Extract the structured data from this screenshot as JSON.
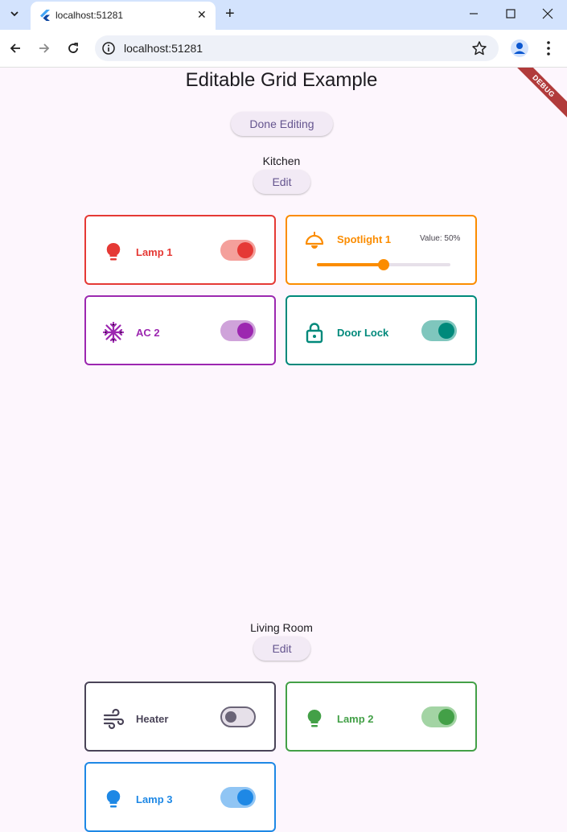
{
  "browser": {
    "tab_title": "localhost:51281",
    "url": "localhost:51281"
  },
  "debug_banner": "DEBUG",
  "app": {
    "title": "Editable Grid Example",
    "done_button": "Done Editing"
  },
  "sections": [
    {
      "name": "Kitchen",
      "edit_label": "Edit",
      "devices": [
        {
          "label": "Lamp 1",
          "icon": "lightbulb-icon",
          "control": "switch",
          "on": true,
          "color": "#e53935"
        },
        {
          "label": "Spotlight 1",
          "icon": "ceiling-light-icon",
          "control": "slider",
          "value": 0.5,
          "value_text": "Value: 50%",
          "color": "#fb8c00"
        },
        {
          "label": "AC 2",
          "icon": "snowflake-icon",
          "control": "switch",
          "on": true,
          "color": "#9c27b0"
        },
        {
          "label": "Door Lock",
          "icon": "lock-icon",
          "control": "switch",
          "on": true,
          "color": "#00897b"
        }
      ]
    },
    {
      "name": "Living Room",
      "edit_label": "Edit",
      "devices": [
        {
          "label": "Heater",
          "icon": "wind-icon",
          "control": "switch",
          "on": false,
          "color": "#4a4458"
        },
        {
          "label": "Lamp 2",
          "icon": "lightbulb-icon",
          "control": "switch",
          "on": true,
          "color": "#43a047"
        },
        {
          "label": "Lamp 3",
          "icon": "lightbulb-icon",
          "control": "switch",
          "on": true,
          "color": "#1e88e5"
        }
      ]
    }
  ]
}
